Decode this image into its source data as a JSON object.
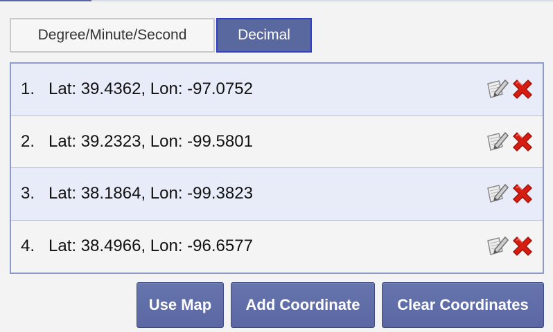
{
  "format_tabs": [
    {
      "label": "Degree/Minute/Second",
      "selected": false
    },
    {
      "label": "Decimal",
      "selected": true
    }
  ],
  "coordinates": [
    {
      "index": "1.",
      "text": "Lat: 39.4362, Lon: -97.0752"
    },
    {
      "index": "2.",
      "text": "Lat: 39.2323, Lon: -99.5801"
    },
    {
      "index": "3.",
      "text": "Lat: 38.1864, Lon: -99.3823"
    },
    {
      "index": "4.",
      "text": "Lat: 38.4966, Lon: -96.6577"
    }
  ],
  "icons": {
    "edit": "edit-icon",
    "delete": "delete-icon"
  },
  "actions": {
    "use_map": "Use Map",
    "add_coordinate": "Add Coordinate",
    "clear_coordinates": "Clear Coordinates"
  },
  "colors": {
    "accent": "#59699f",
    "selected_tab_border": "#2f3fc9",
    "row_highlight": "#e7ecf8",
    "delete_red": "#d61d12"
  }
}
